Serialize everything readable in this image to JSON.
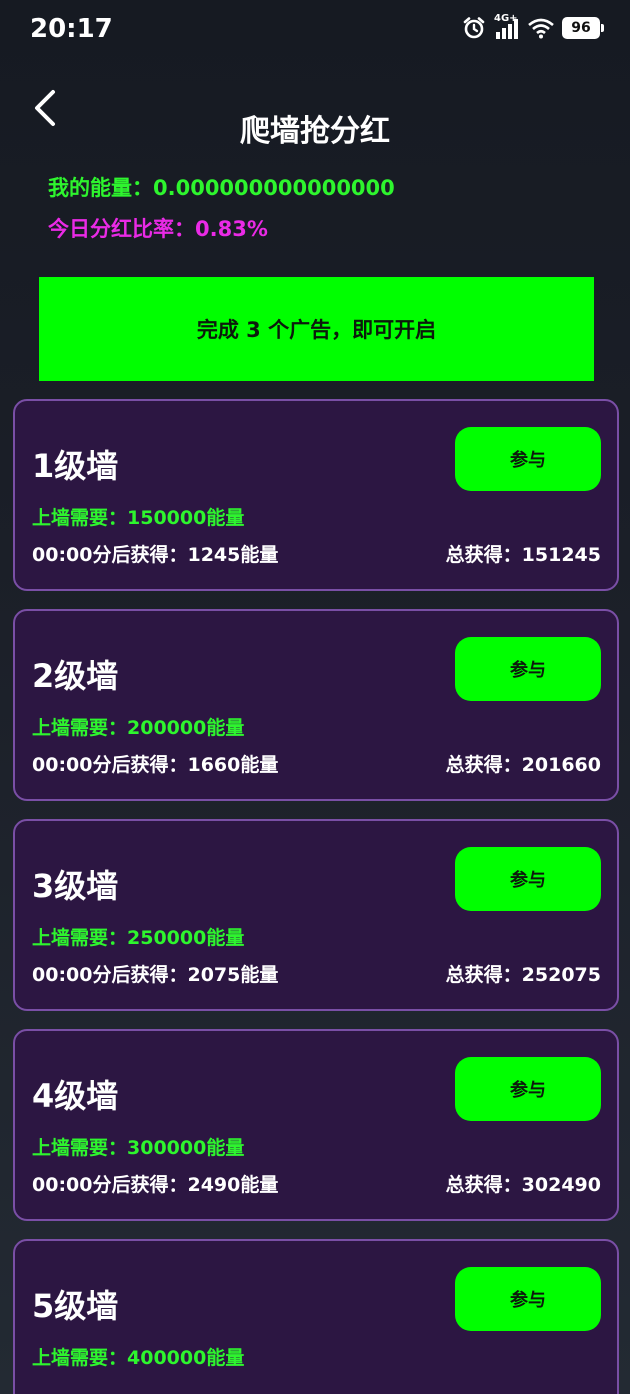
{
  "status_bar": {
    "time": "20:17",
    "network": "4G+",
    "battery": "96",
    "icons": [
      "alarm-icon",
      "signal-icon",
      "wifi-icon",
      "battery-icon"
    ]
  },
  "header": {
    "title": "爬墙抢分红",
    "back_icon": "chevron-left-icon"
  },
  "summary": {
    "energy_label": "我的能量：",
    "energy_value": "0.000000000000000",
    "rate_label": "今日分红比率：",
    "rate_value": "0.83%"
  },
  "banner": {
    "text": "完成 3 个广告，即可开启"
  },
  "walls": [
    {
      "name": "1级墙",
      "join_label": "参与",
      "require_label": "上墙需要：",
      "require_value": "150000能量",
      "earn_label": "00:00分后获得：",
      "earn_value": "1245能量",
      "total_label": "总获得：",
      "total_value": "151245"
    },
    {
      "name": "2级墙",
      "join_label": "参与",
      "require_label": "上墙需要：",
      "require_value": "200000能量",
      "earn_label": "00:00分后获得：",
      "earn_value": "1660能量",
      "total_label": "总获得：",
      "total_value": "201660"
    },
    {
      "name": "3级墙",
      "join_label": "参与",
      "require_label": "上墙需要：",
      "require_value": "250000能量",
      "earn_label": "00:00分后获得：",
      "earn_value": "2075能量",
      "total_label": "总获得：",
      "total_value": "252075"
    },
    {
      "name": "4级墙",
      "join_label": "参与",
      "require_label": "上墙需要：",
      "require_value": "300000能量",
      "earn_label": "00:00分后获得：",
      "earn_value": "2490能量",
      "total_label": "总获得：",
      "total_value": "302490"
    },
    {
      "name": "5级墙",
      "join_label": "参与",
      "require_label": "上墙需要：",
      "require_value": "400000能量",
      "earn_label": "",
      "earn_value": "",
      "total_label": "",
      "total_value": ""
    }
  ],
  "colors": {
    "accent_green": "#00ff00",
    "text_green": "#2ef52e",
    "text_magenta": "#ea2ae6",
    "card_bg": "#2c1642",
    "card_border": "#7a4fa6"
  }
}
